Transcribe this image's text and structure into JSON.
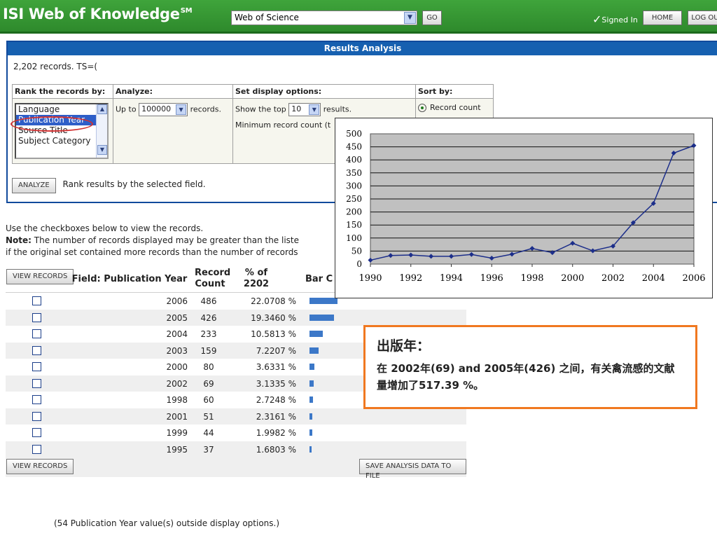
{
  "header": {
    "brand": "ISI Web of Knowledge",
    "brand_mark": "SM",
    "database": "Web of Science",
    "go_label": "GO",
    "signed_in": "Signed In",
    "home_label": "HOME",
    "logout_label": "LOG OU"
  },
  "panel": {
    "title": "Results Analysis",
    "records_line": "2,202 records. TS=(",
    "col_rank": "Rank the records by:",
    "col_analyze": "Analyze:",
    "col_display": "Set display options:",
    "col_sort": "Sort by:",
    "rank_options": [
      "Language",
      "Publication Year",
      "Source Title",
      "Subject Category"
    ],
    "selected_rank": "Publication Year",
    "up_to": "Up to",
    "analyze_value": "100000",
    "records_word": "records.",
    "show_top": "Show the top",
    "top_value": "10",
    "results_word": "results.",
    "minimum": "Minimum record count (t",
    "sort_option": "Record count",
    "analyze_button": "ANALYZE",
    "analyze_hint": "Rank results by the selected field."
  },
  "notes": {
    "line1": "Use the checkboxes below to view the records.",
    "note_label": "Note:",
    "line2": " The number of records displayed may be greater than the liste",
    "line3": "if the original set contained more records than the number of records"
  },
  "results": {
    "view_records": "VIEW RECORDS",
    "field_header": "Field: Publication Year",
    "count_header_1": "Record",
    "count_header_2": "Count",
    "pct_header_1": "% of",
    "pct_header_2": "2202",
    "bar_header": "Bar C",
    "rows": [
      {
        "year": "2006",
        "count": "486",
        "pct": "22.0708 %",
        "share": 22.0708
      },
      {
        "year": "2005",
        "count": "426",
        "pct": "19.3460 %",
        "share": 19.346
      },
      {
        "year": "2004",
        "count": "233",
        "pct": "10.5813 %",
        "share": 10.5813
      },
      {
        "year": "2003",
        "count": "159",
        "pct": "7.2207 %",
        "share": 7.2207
      },
      {
        "year": "2000",
        "count": "80",
        "pct": "3.6331 %",
        "share": 3.6331
      },
      {
        "year": "2002",
        "count": "69",
        "pct": "3.1335 %",
        "share": 3.1335
      },
      {
        "year": "1998",
        "count": "60",
        "pct": "2.7248 %",
        "share": 2.7248
      },
      {
        "year": "2001",
        "count": "51",
        "pct": "2.3161 %",
        "share": 2.3161
      },
      {
        "year": "1999",
        "count": "44",
        "pct": "1.9982 %",
        "share": 1.9982
      },
      {
        "year": "1995",
        "count": "37",
        "pct": "1.6803 %",
        "share": 1.6803
      }
    ],
    "save_button": "SAVE ANALYSIS DATA TO FILE",
    "outside_note": "(54 Publication Year value(s) outside display options.)"
  },
  "chart_data": {
    "type": "line",
    "title": "",
    "xlabel": "",
    "ylabel": "",
    "x": [
      1990,
      1991,
      1992,
      1993,
      1994,
      1995,
      1996,
      1997,
      1998,
      1999,
      2000,
      2001,
      2002,
      2003,
      2004,
      2005,
      2006
    ],
    "series": [
      {
        "values": [
          15,
          33,
          35,
          30,
          30,
          37,
          23,
          38,
          60,
          44,
          80,
          51,
          69,
          159,
          233,
          426,
          455
        ]
      }
    ],
    "x_ticks": [
      "1990",
      "1992",
      "1994",
      "1996",
      "1998",
      "2000",
      "2002",
      "2004",
      "2006"
    ],
    "y_ticks": [
      "0",
      "50",
      "100",
      "150",
      "200",
      "250",
      "300",
      "350",
      "400",
      "450",
      "500"
    ],
    "ylim": [
      0,
      500
    ],
    "grid": true,
    "line_color": "#1c2e8a",
    "plot_bg": "#c0c0c0"
  },
  "callout": {
    "title": "出版年：",
    "text": "在 2002年(69) and 2005年(426) 之间，有关禽流感的文献量增加了517.39 %。"
  }
}
